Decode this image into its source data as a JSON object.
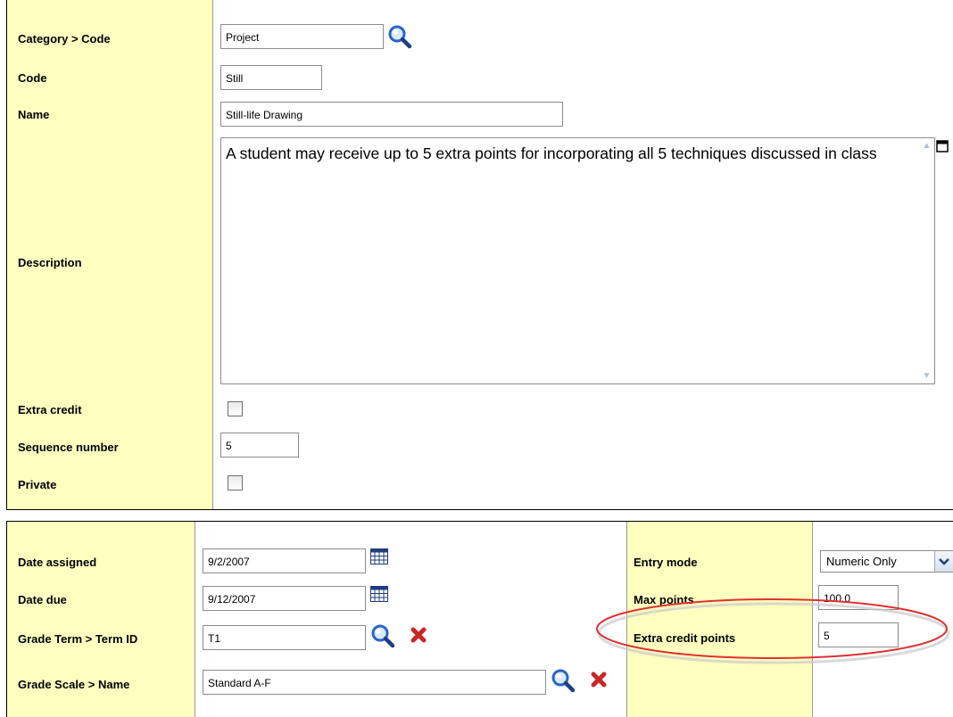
{
  "general": {
    "category_label": "Category > Code",
    "category_value": "Project",
    "code_label": "Code",
    "code_value": "Still",
    "name_label": "Name",
    "name_value": "Still-life Drawing",
    "description_label": "Description",
    "description_value": "A student may receive up to 5 extra points for incorporating all 5 techniques discussed in class",
    "extra_credit_label": "Extra credit",
    "extra_credit_checked": false,
    "sequence_label": "Sequence number",
    "sequence_value": "5",
    "private_label": "Private",
    "private_checked": false
  },
  "grading": {
    "date_assigned_label": "Date assigned",
    "date_assigned_value": "9/2/2007",
    "date_due_label": "Date due",
    "date_due_value": "9/12/2007",
    "grade_term_label": "Grade Term > Term ID",
    "grade_term_value": "T1",
    "grade_scale_label": "Grade Scale > Name",
    "grade_scale_value": "Standard A-F",
    "entry_mode_label": "Entry mode",
    "entry_mode_value": "Numeric Only",
    "max_points_label": "Max points",
    "max_points_value": "100.0",
    "extra_credit_points_label": "Extra credit points",
    "extra_credit_points_value": "5"
  },
  "icons": {
    "lookup": "magnifier-icon",
    "calendar": "calendar-icon",
    "clear": "red-x-icon",
    "expand": "window-expand-icon"
  },
  "colors": {
    "label_background": "#ffffc0",
    "highlight_oval": "#e03030",
    "clear_icon": "#c82828"
  }
}
